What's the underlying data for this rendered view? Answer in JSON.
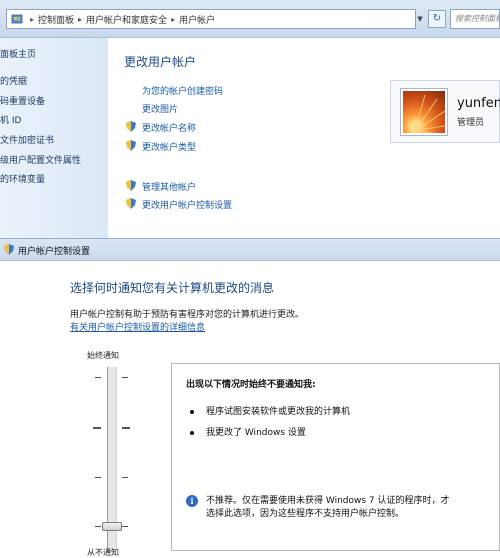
{
  "address_bar": {
    "crumbs": [
      "控制面板",
      "用户帐户和家庭安全",
      "用户帐户"
    ],
    "search_placeholder": "搜索控制面板"
  },
  "sidebar": {
    "items": [
      "面板主页",
      "的凭据",
      "码重置设备",
      "机 ID",
      "文件加密证书",
      "级用户配置文件属性",
      "的环境变量"
    ]
  },
  "control_panel": {
    "title": "更改用户帐户",
    "links": [
      "为您的帐户创建密码",
      "更改图片",
      "更改帐户名称",
      "更改帐户类型",
      "管理其他帐户",
      "更改用户帐户控制设置"
    ]
  },
  "user": {
    "name": "yunfen",
    "role": "管理员"
  },
  "uac": {
    "window_title": "用户帐户控制设置",
    "heading": "选择何时通知您有关计算机更改的消息",
    "description": "用户帐户控制有助于预防有害程序对您的计算机进行更改。",
    "more_link": "有关用户帐户控制设置的详细信息",
    "slider_top_label": "始终通知",
    "slider_bottom_label": "从不通知",
    "slider_level_index_from_top": 3,
    "slider_levels": 4,
    "panel_heading": "出现以下情况时始终不要通知我:",
    "bullets": [
      "程序试图安装软件或更改我的计算机",
      "我更改了 Windows 设置"
    ],
    "note": "不推荐。仅在需要使用未获得 Windows 7 认证的程序时，才选择此选项，因为这些程序不支持用户帐户控制。"
  },
  "colors": {
    "link": "#1a5aa6",
    "heading": "#1e4b87",
    "sidebar_bg": "#e3edf9"
  }
}
